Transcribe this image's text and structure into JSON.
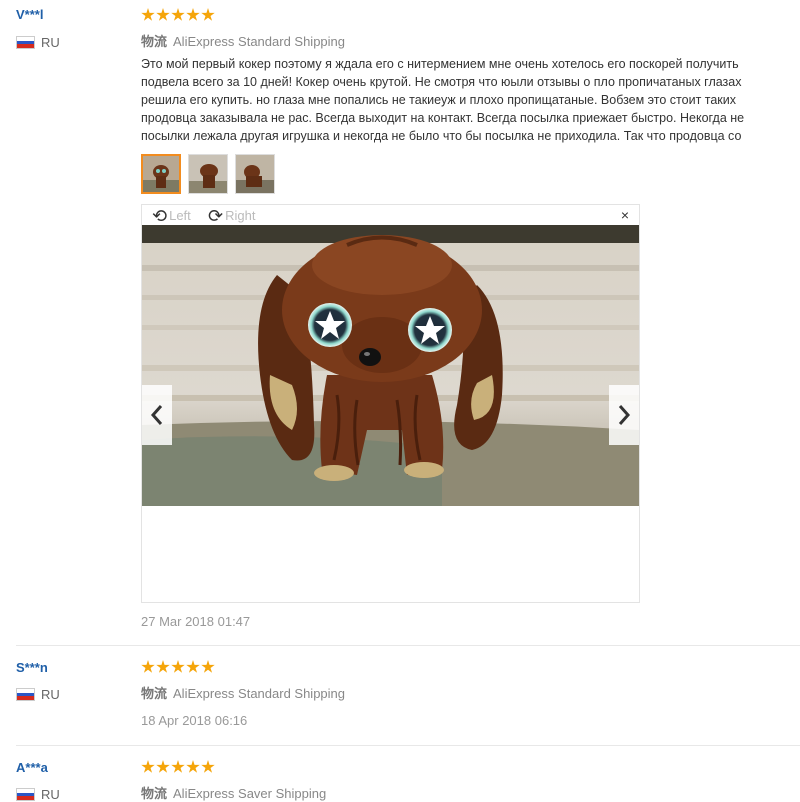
{
  "reviews": [
    {
      "user": "V***l",
      "country": "RU",
      "shipping_label": "物流",
      "shipping": "AliExpress Standard Shipping",
      "rating": 5,
      "text_lines": [
        "Это мой первый кокер поэтому я ждала его с нитермением мне очень хотелось его поскорей получить",
        "подвела всего за 10 дней! Кокер очень крутой. Не смотря что юыли отзывы о пло пропичатаных глазах",
        "решила его купить. но глаза мне попались не такиеуж и плохо пропищатаные. Вобзем это стоит таких",
        "продовца заказывала не рас. Всегда выходит на контакт. Всегда посылка приежает быстро. Некогда не",
        "посылки лежала другая игрушка и некогда не было что бы посылка не приходила. Так что продовца со"
      ],
      "date": "27 Mar 2018 01:47",
      "viewer": {
        "rotate_left": "Left",
        "rotate_right": "Right",
        "close": "×"
      }
    },
    {
      "user": "S***n",
      "country": "RU",
      "shipping_label": "物流",
      "shipping": "AliExpress Standard Shipping",
      "rating": 5,
      "date": "18 Apr 2018 06:16"
    },
    {
      "user": "A***a",
      "country": "RU",
      "shipping_label": "物流",
      "shipping": "AliExpress Saver Shipping",
      "rating": 5
    }
  ],
  "icons": {
    "flag": "russia-flag-icon",
    "star": "star-icon",
    "rotate_left": "rotate-left-icon",
    "rotate_right": "rotate-right-icon",
    "prev": "chevron-left-icon",
    "next": "chevron-right-icon"
  },
  "colors": {
    "star": "#f5a50a",
    "username": "#1f5fa8",
    "active_thumb": "#f28c1f"
  }
}
